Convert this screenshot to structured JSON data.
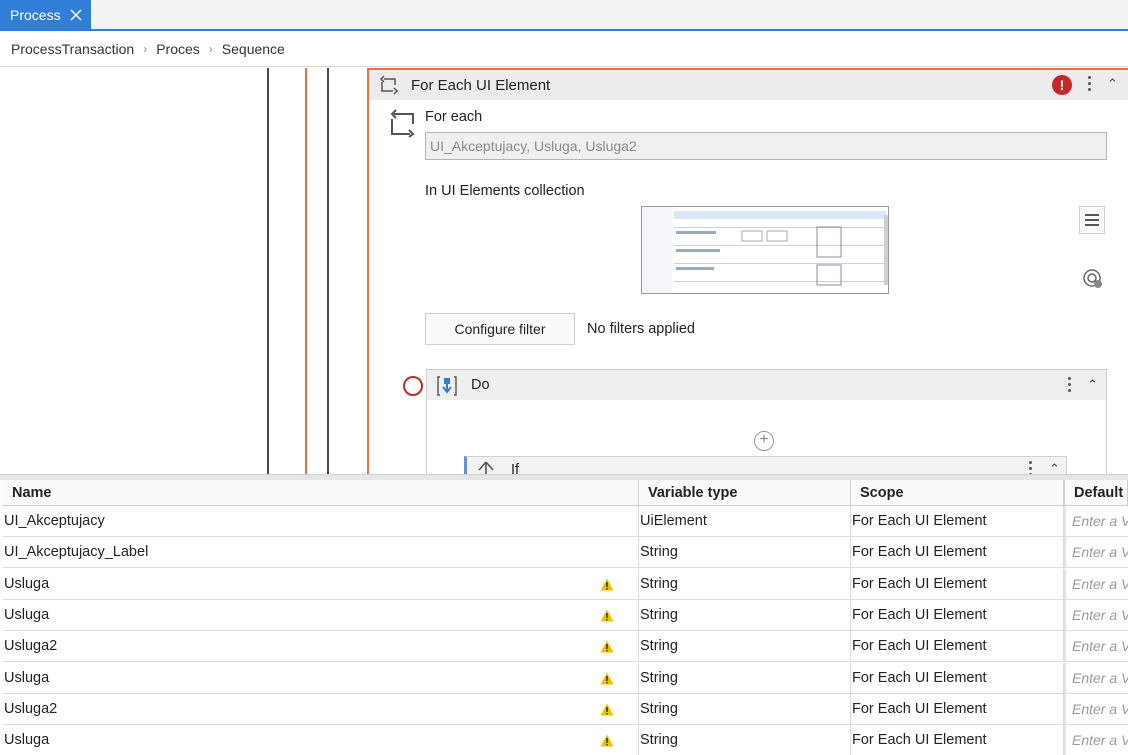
{
  "tab": {
    "label": "Process"
  },
  "breadcrumb": [
    "ProcessTransaction",
    "Proces",
    "Sequence"
  ],
  "activity": {
    "title": "For Each UI Element",
    "for_each_label": "For each",
    "for_each_value": "UI_Akceptujacy, Usluga, Usluga2",
    "collection_label": "In UI Elements collection",
    "configure_filter": "Configure filter",
    "filter_status": "No filters applied",
    "do_label": "Do",
    "if_label": "If"
  },
  "variables": {
    "columns": [
      "Name",
      "Variable type",
      "Scope",
      "Default"
    ],
    "default_placeholder": "Enter a V",
    "rows": [
      {
        "name": "UI_Akceptujacy",
        "type": "UiElement",
        "scope": "For Each UI Element",
        "warning": false
      },
      {
        "name": "UI_Akceptujacy_Label",
        "type": "String",
        "scope": "For Each UI Element",
        "warning": false
      },
      {
        "name": "Usluga",
        "type": "String",
        "scope": "For Each UI Element",
        "warning": true
      },
      {
        "name": "Usluga",
        "type": "String",
        "scope": "For Each UI Element",
        "warning": true
      },
      {
        "name": "Usluga2",
        "type": "String",
        "scope": "For Each UI Element",
        "warning": true
      },
      {
        "name": "Usluga",
        "type": "String",
        "scope": "For Each UI Element",
        "warning": true
      },
      {
        "name": "Usluga2",
        "type": "String",
        "scope": "For Each UI Element",
        "warning": true
      },
      {
        "name": "Usluga",
        "type": "String",
        "scope": "For Each UI Element",
        "warning": true
      }
    ]
  },
  "colors": {
    "accent": "#2f7fd8",
    "selection_border": "#ee6d3a",
    "error": "#c62828",
    "warning": "#f2c200"
  }
}
